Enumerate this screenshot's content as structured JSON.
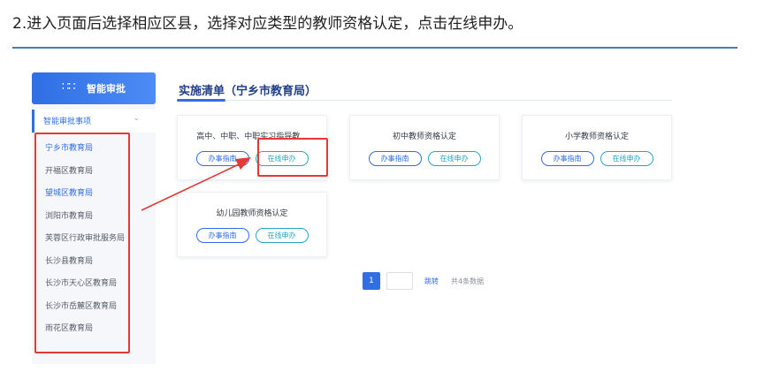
{
  "instruction": "2.进入页面后选择相应区县，选择对应类型的教师资格认定，点击在线申办。",
  "sidebar": {
    "brand_icon": "apps-icon",
    "brand_label": "智能审批",
    "menu_header": "智能审批事项",
    "districts": [
      {
        "label": "宁乡市教育局",
        "active": true
      },
      {
        "label": "开福区教育局",
        "active": false
      },
      {
        "label": "望城区教育局",
        "active": true
      },
      {
        "label": "浏阳市教育局",
        "active": false
      },
      {
        "label": "芙蓉区行政审批服务局",
        "active": false
      },
      {
        "label": "长沙县教育局",
        "active": false
      },
      {
        "label": "长沙市天心区教育局",
        "active": false
      },
      {
        "label": "长沙市岳麓区教育局",
        "active": false
      },
      {
        "label": "雨花区教育局",
        "active": false
      }
    ]
  },
  "main": {
    "list_title": "实施清单（宁乡市教育局）",
    "cards": [
      {
        "title": "高中、中职、中职实习指导教...",
        "guide": "办事指南",
        "apply": "在线申办"
      },
      {
        "title": "初中教师资格认定",
        "guide": "办事指南",
        "apply": "在线申办"
      },
      {
        "title": "小学教师资格认定",
        "guide": "办事指南",
        "apply": "在线申办"
      },
      {
        "title": "幼儿园教师资格认定",
        "guide": "办事指南",
        "apply": "在线申办"
      }
    ]
  },
  "pagination": {
    "current_page": "1",
    "jump_label": "跳转",
    "total_text": "共4条数据"
  },
  "colors": {
    "accent": "#2f6ee3",
    "highlight": "#e53935",
    "apply_teal": "#26a6c9",
    "title_navy": "#1f3f86"
  }
}
